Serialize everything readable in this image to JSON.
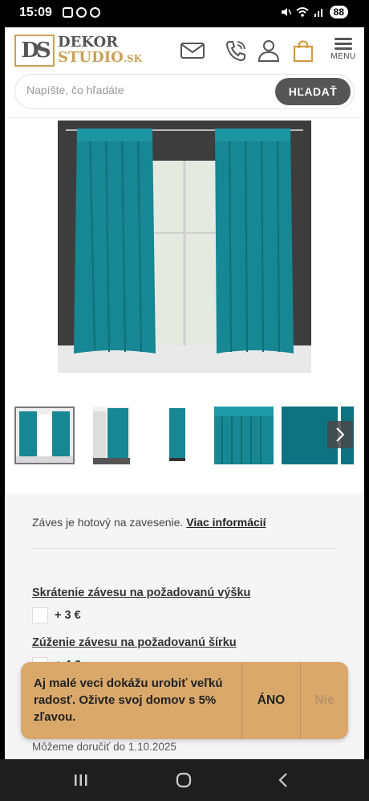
{
  "status_bar": {
    "time": "15:09",
    "battery": "88"
  },
  "header": {
    "logo_mark": "DS",
    "logo_line1": "DEKOR",
    "logo_line2": "STUDIO",
    "logo_suffix": ".SK",
    "menu_label": "MENU",
    "brand_color": "#c9a15a"
  },
  "search": {
    "placeholder": "Napíšte, čo hľadáte",
    "button_label": "HĽADAŤ"
  },
  "gallery": {
    "main_alt": "teal curtains on window",
    "thumbnail_count": 6,
    "curtain_color": "#1a8c98"
  },
  "info": {
    "ready_text": "Záves je hotový na zavesenie.",
    "more_link": "Viac informácií",
    "option1_title": "Skrátenie závesu na požadovanú výšku",
    "option1_price": "+ 3 €",
    "option2_title": "Zúženie závesu na požadovanú šírku",
    "option2_price": "+ 4 €",
    "delivery": "Môžeme doručiť do 1.10.2025"
  },
  "popup": {
    "message": "Aj malé veci dokážu urobiť veľkú radosť. Oživte svoj domov s 5% zľavou.",
    "yes_label": "ÁNO",
    "no_label": "Nie",
    "bg_color": "#d9a86a"
  }
}
